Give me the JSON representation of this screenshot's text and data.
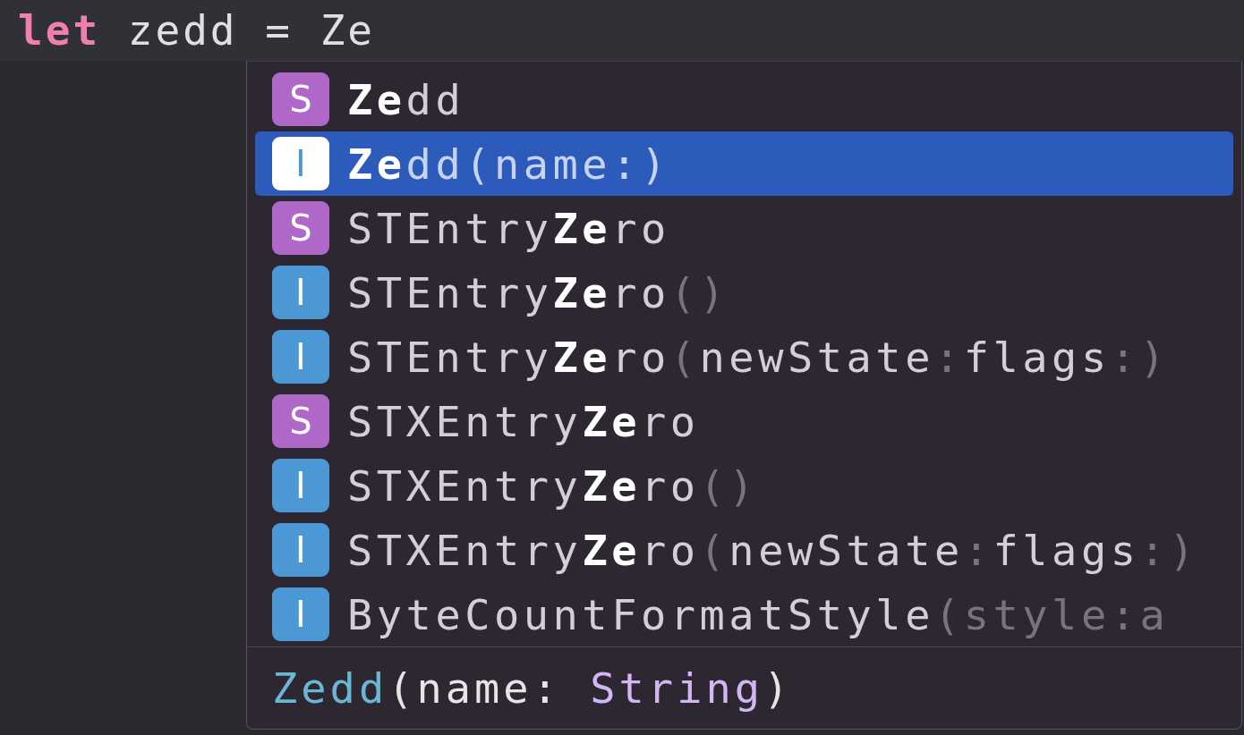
{
  "editor": {
    "line": [
      {
        "kind": "keyword",
        "text": "let"
      },
      {
        "kind": "plain",
        "text": " zedd = Ze"
      }
    ]
  },
  "completions": [
    {
      "badge": "S",
      "color": "#b068c8",
      "selected": false,
      "label": [
        {
          "kind": "match",
          "text": "Ze"
        },
        {
          "kind": "name",
          "text": "dd"
        }
      ]
    },
    {
      "badge": "I",
      "color": "#4b98d4",
      "selected": true,
      "label": [
        {
          "kind": "match",
          "text": "Ze"
        },
        {
          "kind": "name",
          "text": "dd(name:)"
        }
      ]
    },
    {
      "badge": "S",
      "color": "#b068c8",
      "selected": false,
      "label": [
        {
          "kind": "name",
          "text": "STEntry"
        },
        {
          "kind": "match",
          "text": "Ze"
        },
        {
          "kind": "name",
          "text": "ro"
        }
      ]
    },
    {
      "badge": "I",
      "color": "#4b98d4",
      "selected": false,
      "label": [
        {
          "kind": "name",
          "text": "STEntry"
        },
        {
          "kind": "match",
          "text": "Ze"
        },
        {
          "kind": "name",
          "text": "ro"
        },
        {
          "kind": "punct",
          "text": "()"
        }
      ]
    },
    {
      "badge": "I",
      "color": "#4b98d4",
      "selected": false,
      "label": [
        {
          "kind": "name",
          "text": "STEntry"
        },
        {
          "kind": "match",
          "text": "Ze"
        },
        {
          "kind": "name",
          "text": "ro"
        },
        {
          "kind": "punct",
          "text": "("
        },
        {
          "kind": "name",
          "text": "newState"
        },
        {
          "kind": "punct",
          "text": ":"
        },
        {
          "kind": "name",
          "text": "flags"
        },
        {
          "kind": "punct",
          "text": ":)"
        }
      ]
    },
    {
      "badge": "S",
      "color": "#b068c8",
      "selected": false,
      "label": [
        {
          "kind": "name",
          "text": "STXEntry"
        },
        {
          "kind": "match",
          "text": "Ze"
        },
        {
          "kind": "name",
          "text": "ro"
        }
      ]
    },
    {
      "badge": "I",
      "color": "#4b98d4",
      "selected": false,
      "label": [
        {
          "kind": "name",
          "text": "STXEntry"
        },
        {
          "kind": "match",
          "text": "Ze"
        },
        {
          "kind": "name",
          "text": "ro"
        },
        {
          "kind": "punct",
          "text": "()"
        }
      ]
    },
    {
      "badge": "I",
      "color": "#4b98d4",
      "selected": false,
      "label": [
        {
          "kind": "name",
          "text": "STXEntry"
        },
        {
          "kind": "match",
          "text": "Ze"
        },
        {
          "kind": "name",
          "text": "ro"
        },
        {
          "kind": "punct",
          "text": "("
        },
        {
          "kind": "name",
          "text": "newState"
        },
        {
          "kind": "punct",
          "text": ":"
        },
        {
          "kind": "name",
          "text": "flags"
        },
        {
          "kind": "punct",
          "text": ":)"
        }
      ]
    },
    {
      "badge": "I",
      "color": "#4b98d4",
      "selected": false,
      "label": [
        {
          "kind": "name",
          "text": "ByteCountFormatStyle"
        },
        {
          "kind": "punct",
          "text": "(style:a"
        }
      ]
    }
  ],
  "signature": [
    {
      "kind": "type",
      "text": "Zedd"
    },
    {
      "kind": "plain",
      "text": "(name: "
    },
    {
      "kind": "keyword",
      "text": "String"
    },
    {
      "kind": "plain",
      "text": ")"
    }
  ]
}
